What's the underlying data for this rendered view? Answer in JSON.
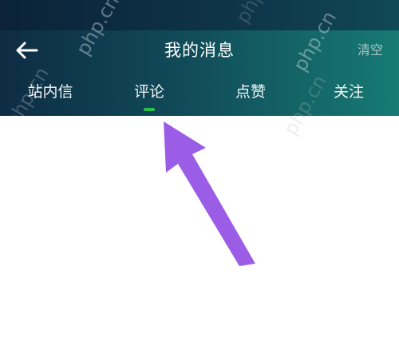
{
  "header": {
    "title": "我的消息",
    "clear_label": "清空",
    "back_icon": "arrow-left-icon"
  },
  "tabs": [
    {
      "label": "站内信",
      "selected": false
    },
    {
      "label": "评论",
      "selected": true
    },
    {
      "label": "点赞",
      "selected": false
    },
    {
      "label": "关注",
      "selected": false
    }
  ],
  "watermark": {
    "text": "php.cn"
  },
  "colors": {
    "header_dark": "#0d2c44",
    "header_light": "#177a73",
    "indicator": "#27c24a",
    "annotation_arrow": "#9b5de5"
  }
}
